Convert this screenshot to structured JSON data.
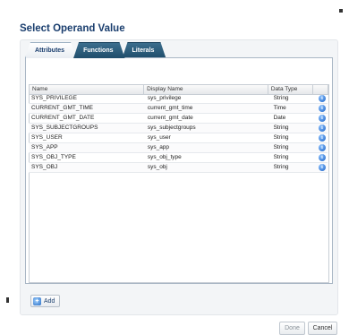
{
  "dialog": {
    "title": "Select Operand Value"
  },
  "tabs": [
    {
      "label": "Attributes",
      "active": true
    },
    {
      "label": "Functions",
      "active": false
    },
    {
      "label": "Literals",
      "active": false
    }
  ],
  "table": {
    "columns": [
      "Name",
      "Display Name",
      "Data Type"
    ],
    "rows": [
      {
        "name": "SYS_PRIVILEGE",
        "display": "sys_privilege",
        "type": "String"
      },
      {
        "name": "CURRENT_GMT_TIME",
        "display": "current_gmt_time",
        "type": "Time"
      },
      {
        "name": "CURRENT_GMT_DATE",
        "display": "current_gmt_date",
        "type": "Date"
      },
      {
        "name": "SYS_SUBJECTGROUPS",
        "display": "sys_subjectgroups",
        "type": "String"
      },
      {
        "name": "SYS_USER",
        "display": "sys_user",
        "type": "String"
      },
      {
        "name": "SYS_APP",
        "display": "sys_app",
        "type": "String"
      },
      {
        "name": "SYS_OBJ_TYPE",
        "display": "sys_obj_type",
        "type": "String"
      },
      {
        "name": "SYS_OBJ",
        "display": "sys_obj",
        "type": "String"
      }
    ],
    "row_icon": "info-icon"
  },
  "buttons": {
    "add": "Add",
    "add_icon": "add-icon",
    "done": "Done",
    "cancel": "Cancel"
  }
}
